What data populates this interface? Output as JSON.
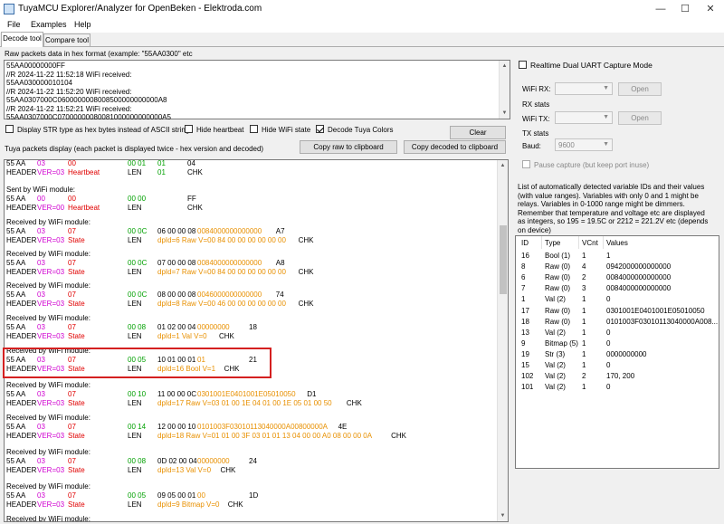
{
  "window": {
    "title": "TuyaMCU Explorer/Analyzer for OpenBeken - Elektroda.com",
    "minimize": "—",
    "maximize": "☐",
    "close": "✕"
  },
  "menu": [
    "File",
    "Examples",
    "Help"
  ],
  "tabs": [
    "Decode tool",
    "Compare tool"
  ],
  "raw_input": {
    "label": "Raw packets data in hex format (example: \"55AA0300\" etc",
    "lines": [
      "55AA00000000FF",
      "//R 2024-11-22 11:52:18 WiFi received:",
      "55AA030000010104",
      "//R 2024-11-22 11:52:20 WiFi received:",
      "55AA0307000C0600000008008500000000000A8",
      "//R 2024-11-22 11:52:21 WiFi received:",
      "55AA0307000C07000000080081000000000000A5"
    ]
  },
  "options": {
    "display_str": "Display STR type as hex bytes instead of ASCII string",
    "hide_heartbeat": "Hide heartbeat",
    "hide_wifi": "Hide WiFi state",
    "decode_colors": "Decode Tuya Colors",
    "decode_colors_checked": true,
    "clear": "Clear"
  },
  "packets_display": {
    "label": "Tuya packets display (each packet is displayed twice - hex version and decoded)",
    "copy_raw": "Copy raw to clipboard",
    "copy_decoded": "Copy decoded to clipboard",
    "header_text": "HEADER",
    "len_text": "LEN",
    "chk_text": "CHK",
    "packets": [
      {
        "title": "",
        "hex_head": "55 AA",
        "ver_hex": "03",
        "cmd_hex": "00",
        "len_hex": "00 01",
        "data_hex": "01",
        "chk_hex": "04",
        "ver": "VER=03",
        "cmd": "Heartbeat",
        "decoded": "01"
      },
      {
        "title": "Sent by WiFi module:",
        "hex_head": "55 AA",
        "ver_hex": "00",
        "cmd_hex": "00",
        "len_hex": "00 00",
        "data_hex": "",
        "chk_hex": "FF",
        "ver": "VER=00",
        "cmd": "Heartbeat",
        "decoded": ""
      },
      {
        "title": "Received by WiFi module:",
        "hex_head": "55 AA",
        "ver_hex": "03",
        "cmd_hex": "07",
        "len_hex": "00 0C",
        "dp_hex": "06 00 00 08",
        "val_hex": "0084000000000000",
        "chk_hex": "A7",
        "ver": "VER=03",
        "cmd": "State",
        "decoded": "dpId=6 Raw V=00 84 00 00 00 00 00 00"
      },
      {
        "title": "Received by WiFi module:",
        "hex_head": "55 AA",
        "ver_hex": "03",
        "cmd_hex": "07",
        "len_hex": "00 0C",
        "dp_hex": "07 00 00 08",
        "val_hex": "0084000000000000",
        "chk_hex": "A8",
        "ver": "VER=03",
        "cmd": "State",
        "decoded": "dpId=7 Raw V=00 84 00 00 00 00 00 00"
      },
      {
        "title": "Received by WiFi module:",
        "hex_head": "55 AA",
        "ver_hex": "03",
        "cmd_hex": "07",
        "len_hex": "00 0C",
        "dp_hex": "08 00 00 08",
        "val_hex": "0046000000000000",
        "chk_hex": "74",
        "ver": "VER=03",
        "cmd": "State",
        "decoded": "dpId=8 Raw V=00 46 00 00 00 00 00 00"
      },
      {
        "title": "Received by WiFi module:",
        "hex_head": "55 AA",
        "ver_hex": "03",
        "cmd_hex": "07",
        "len_hex": "00 08",
        "dp_hex": "01 02 00 04",
        "val_hex": "00000000",
        "chk_hex": "18",
        "ver": "VER=03",
        "cmd": "State",
        "decoded": "dpId=1 Val V=0"
      },
      {
        "title": "Received by WiFi module:",
        "hex_head": "55 AA",
        "ver_hex": "03",
        "cmd_hex": "07",
        "len_hex": "00 05",
        "dp_hex": "10 01 00 01",
        "val_hex": "01",
        "chk_hex": "21",
        "ver": "VER=03",
        "cmd": "State",
        "decoded": "dpId=16 Bool V=1"
      },
      {
        "title": "Received by WiFi module:",
        "hex_head": "55 AA",
        "ver_hex": "03",
        "cmd_hex": "07",
        "len_hex": "00 10",
        "dp_hex": "11 00 00 0C",
        "val_hex": "0301001E0401001E05010050",
        "chk_hex": "D1",
        "ver": "VER=03",
        "cmd": "State",
        "decoded": "dpId=17 Raw V=03 01 00 1E 04 01 00 1E 05 01 00 50"
      },
      {
        "title": "Received by WiFi module:",
        "hex_head": "55 AA",
        "ver_hex": "03",
        "cmd_hex": "07",
        "len_hex": "00 14",
        "dp_hex": "12 00 00 10",
        "val_hex": "0101003F03010113040000A00800000A",
        "chk_hex": "4E",
        "ver": "VER=03",
        "cmd": "State",
        "decoded": "dpId=18 Raw V=01 01 00 3F 03 01 01 13 04 00 00 A0 08 00 00 0A"
      },
      {
        "title": "Received by WiFi module:",
        "hex_head": "55 AA",
        "ver_hex": "03",
        "cmd_hex": "07",
        "len_hex": "00 08",
        "dp_hex": "0D 02 00 04",
        "val_hex": "00000000",
        "chk_hex": "24",
        "ver": "VER=03",
        "cmd": "State",
        "decoded": "dpId=13 Val V=0"
      },
      {
        "title": "Received by WiFi module:",
        "hex_head": "55 AA",
        "ver_hex": "03",
        "cmd_hex": "07",
        "len_hex": "00 05",
        "dp_hex": "09 05 00 01",
        "val_hex": "00",
        "chk_hex": "1D",
        "ver": "VER=03",
        "cmd": "State",
        "decoded": "dpId=9 Bitmap V=0"
      },
      {
        "title": "Received by WiFi module:"
      }
    ]
  },
  "right_panel": {
    "realtime": "Realtime Dual UART Capture Mode",
    "wifi_rx": "WiFi RX:",
    "rx_stats": "RX stats",
    "wifi_tx": "WiFi TX:",
    "tx_stats": "TX stats",
    "baud_label": "Baud:",
    "baud_value": "9600",
    "open": "Open",
    "pause": "Pause capture (but keep port inuse)",
    "info": [
      "List of automatically detected variable IDs  and their values",
      "(with value ranges). Variables with only 0 and 1 might be",
      "relays. Variables in 0-1000 range might be dimmers.",
      "Remember that temperature and voltage etc are displayed",
      "as integers, so 195 = 19.5C or 2212 = 221.2V etc (depends",
      "on device)"
    ],
    "table": {
      "headers": [
        "ID",
        "Type",
        "VCnt",
        "Values"
      ],
      "rows": [
        [
          "16",
          "Bool (1)",
          "1",
          "1"
        ],
        [
          "8",
          "Raw (0)",
          "4",
          "0942000000000000"
        ],
        [
          "6",
          "Raw (0)",
          "2",
          "0084000000000000"
        ],
        [
          "7",
          "Raw (0)",
          "3",
          "0084000000000000"
        ],
        [
          "1",
          "Val (2)",
          "1",
          "0"
        ],
        [
          "17",
          "Raw (0)",
          "1",
          "0301001E0401001E05010050"
        ],
        [
          "18",
          "Raw (0)",
          "1",
          "0101003F03010113040000A008..."
        ],
        [
          "13",
          "Val (2)",
          "1",
          "0"
        ],
        [
          "9",
          "Bitmap (5)",
          "1",
          "0"
        ],
        [
          "19",
          "Str (3)",
          "1",
          "0000000000"
        ],
        [
          "15",
          "Val (2)",
          "1",
          "0"
        ],
        [
          "102",
          "Val (2)",
          "2",
          "170, 200"
        ],
        [
          "101",
          "Val (2)",
          "1",
          "0"
        ]
      ]
    }
  }
}
